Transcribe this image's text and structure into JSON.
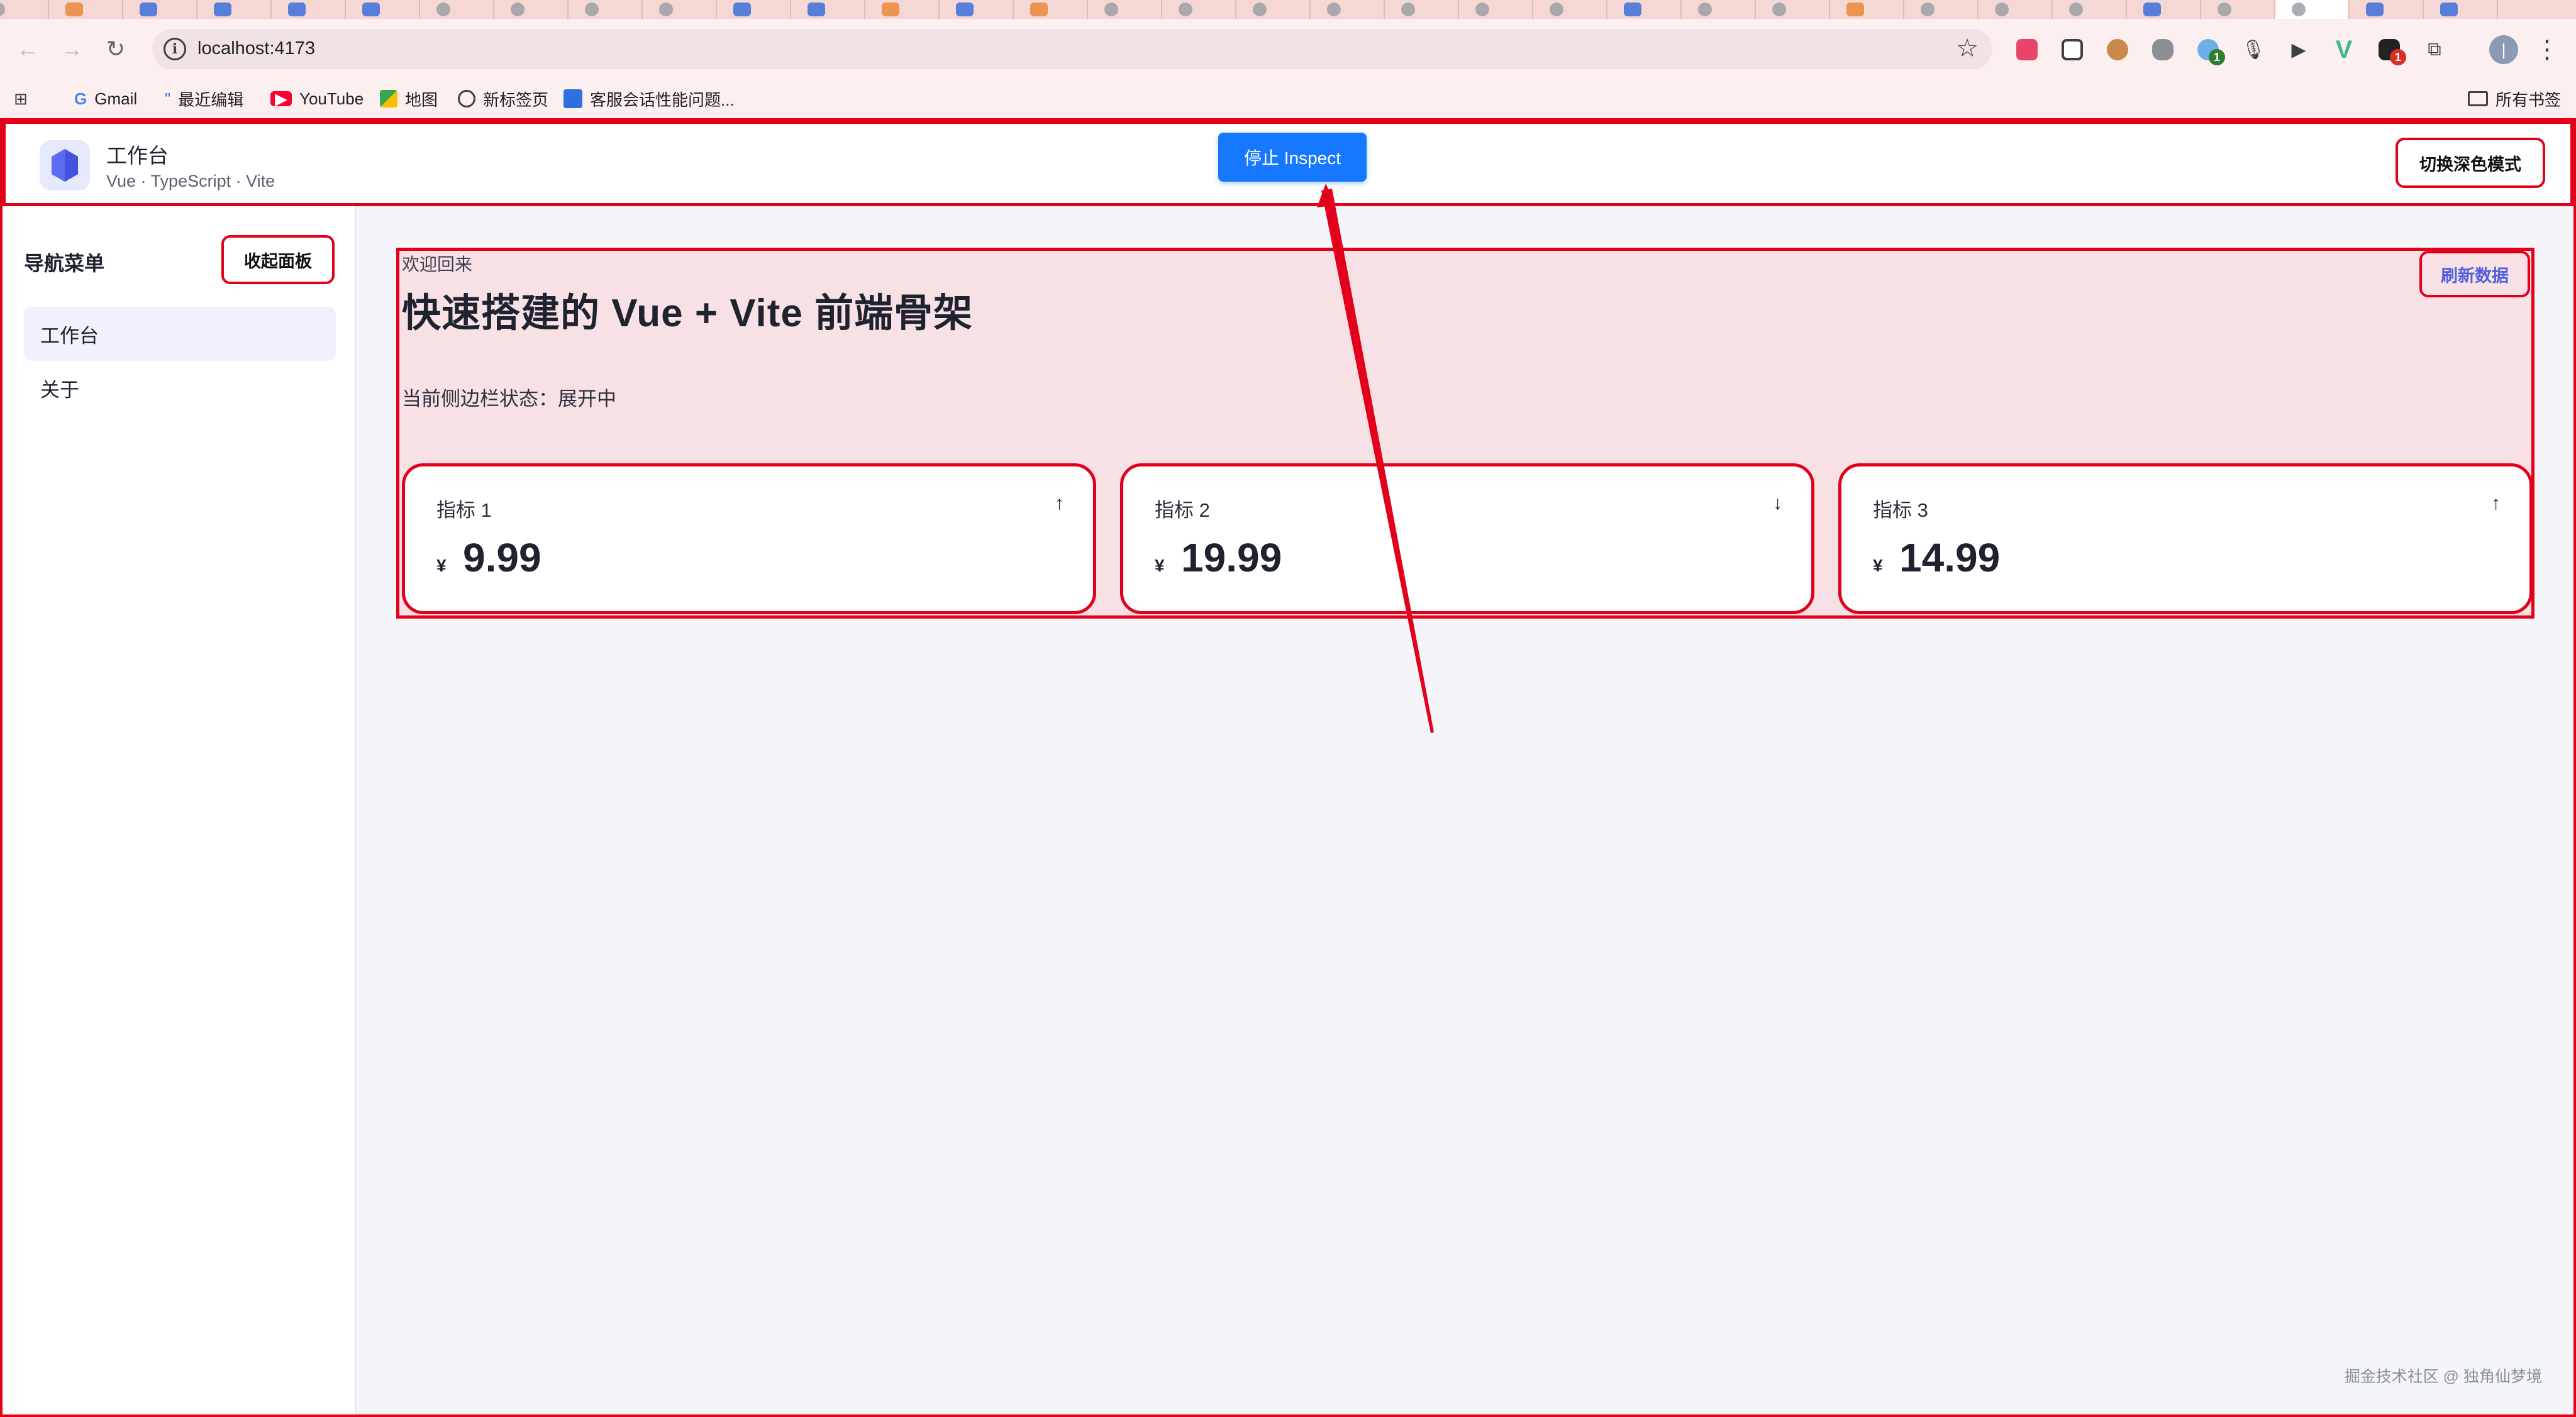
{
  "browser": {
    "url": "localhost:4173",
    "bookmarks": [
      "Gmail",
      "最近编辑",
      "YouTube",
      "地图",
      "新标签页",
      "客服会话性能问题..."
    ],
    "all_bookmarks": "所有书签",
    "extension_badges": [
      "1",
      "1"
    ]
  },
  "app": {
    "title": "工作台",
    "subtitle": "Vue · TypeScript · Vite",
    "inspect_label": "停止 Inspect",
    "dark_mode_label": "切换深色模式"
  },
  "sidebar": {
    "title": "导航菜单",
    "collapse_label": "收起面板",
    "items": [
      {
        "label": "工作台",
        "active": true
      },
      {
        "label": "关于",
        "active": false
      }
    ]
  },
  "main": {
    "welcome": "欢迎回来",
    "title": "快速搭建的 Vue + Vite 前端骨架",
    "sidebar_state": "当前侧边栏状态：展开中",
    "refresh_label": "刷新数据",
    "currency": "¥",
    "cards": [
      {
        "label": "指标 1",
        "value": "9.99",
        "trend": "↑"
      },
      {
        "label": "指标 2",
        "value": "19.99",
        "trend": "↓"
      },
      {
        "label": "指标 3",
        "value": "14.99",
        "trend": "↑"
      }
    ]
  },
  "watermark": "掘金技术社区 @ 独角仙梦境",
  "colors": {
    "highlight": "#e3001b",
    "primary": "#1677ff",
    "panel_bg": "#f7e1e4",
    "link": "#4f5fe0"
  }
}
